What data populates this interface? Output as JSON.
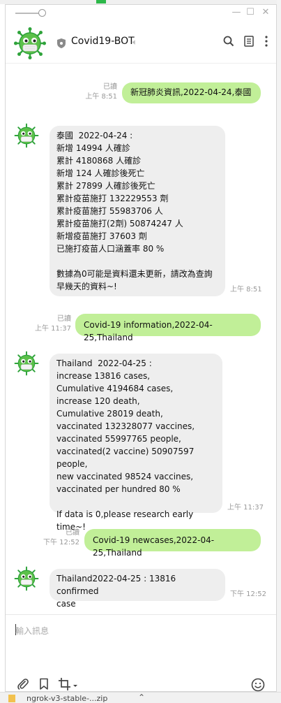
{
  "header": {
    "chat_name": "Covid19-BOT"
  },
  "messages": [
    {
      "dir": "out",
      "status": "已讀",
      "time": "上午 8:51",
      "text": "新冠肺炎資訊,2022-04-24,泰國"
    },
    {
      "dir": "in",
      "time": "上午 8:51",
      "text": "泰國  2022-04-24 :\n新增 14994 人確診\n累計 4180868 人確診\n新增 124 人確診後死亡\n累計 27899 人確診後死亡\n累計疫苗施打 132229553 劑\n累計疫苗施打 55983706 人\n累計疫苗施打(2劑) 50874247 人\n新增疫苗施打 37603 劑\n已施打疫苗人口涵蓋率 80 %\n\n數據為0可能是資料還未更新，請改為查詢早幾天的資料~!"
    },
    {
      "dir": "out",
      "status": "已讀",
      "time": "上午 11:37",
      "text": "Covid-19 information,2022-04-25,Thailand"
    },
    {
      "dir": "in",
      "time": "上午 11:37",
      "text": "Thailand  2022-04-25 :\nincrease 13816 cases,\nCumulative 4194684 cases,\nincrease 120 death,\nCumulative 28019 death,\nvaccinated 132328077 vaccines,\nvaccinated 55997765 people,\nvaccinated(2 vaccine) 50907597 people,\nnew vaccinated 98524 vaccines,\nvaccinated per hundred 80 %\n\nIf data is 0,please research early time~!"
    },
    {
      "dir": "out",
      "status": "已讀",
      "time": "下午 12:52",
      "text": "Covid-19 newcases,2022-04-25,Thailand"
    },
    {
      "dir": "in",
      "time": "下午 12:52",
      "text": "Thailand2022-04-25 : 13816 confirmed\ncase"
    }
  ],
  "input": {
    "placeholder": "輸入訊息"
  },
  "background": {
    "taskbar_file": "ngrok-v3-stable-...zip"
  },
  "colors": {
    "outgoing_bubble": "#c1ef98",
    "incoming_bubble": "#eeeeee"
  },
  "icons": [
    "shield-icon",
    "speaker-muted-icon",
    "search-icon",
    "notes-icon",
    "more-icon",
    "attach-icon",
    "bookmark-icon",
    "crop-icon",
    "emoji-icon",
    "minimize-icon",
    "maximize-icon",
    "close-icon",
    "bot-avatar"
  ]
}
